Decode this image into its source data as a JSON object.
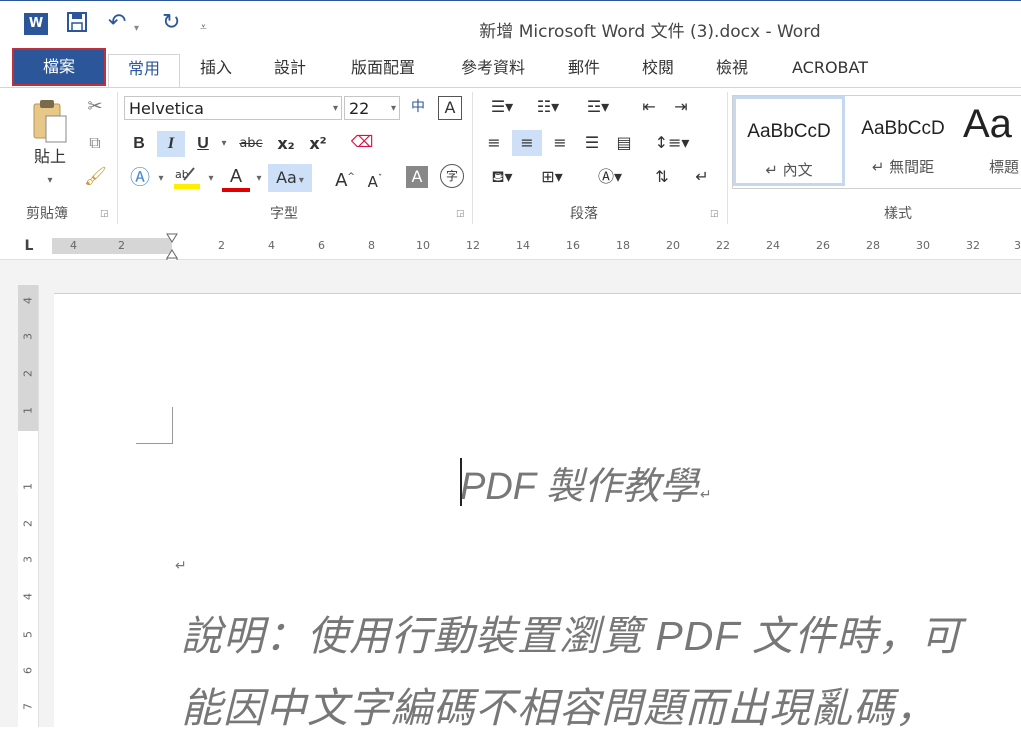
{
  "window": {
    "title": "新增 Microsoft Word 文件 (3).docx - Word"
  },
  "quick_access": {
    "app_icon": "word-icon",
    "save": "save-icon",
    "undo": "undo-icon",
    "redo": "redo-icon",
    "customize": "customize-icon"
  },
  "tabs": [
    {
      "label": "檔案"
    },
    {
      "label": "常用"
    },
    {
      "label": "插入"
    },
    {
      "label": "設計"
    },
    {
      "label": "版面配置"
    },
    {
      "label": "參考資料"
    },
    {
      "label": "郵件"
    },
    {
      "label": "校閱"
    },
    {
      "label": "檢視"
    },
    {
      "label": "ACROBAT"
    }
  ],
  "ribbon": {
    "clipboard": {
      "paste_label": "貼上",
      "group_label": "剪貼簿"
    },
    "font": {
      "family": "Helvetica",
      "size": "22",
      "group_label": "字型",
      "bold": "B",
      "italic": "I",
      "underline": "U",
      "strike": "abc",
      "subscript": "x₂",
      "superscript": "x²",
      "font_color_letter": "A",
      "change_case": "Aa",
      "grow": "A",
      "shrink": "A",
      "zhuyin": "中",
      "boxed": "A",
      "shade": "A",
      "enclosed": "字"
    },
    "paragraph": {
      "group_label": "段落"
    },
    "styles": {
      "group_label": "樣式",
      "items": [
        {
          "sample": "AaBbCcD",
          "name": "↵ 內文"
        },
        {
          "sample": "AaBbCcD",
          "name": "↵ 無間距"
        },
        {
          "sample": "Aa",
          "name": "標題"
        }
      ]
    }
  },
  "ruler": {
    "tab_selector": "L",
    "ticks": [
      "4",
      "2",
      "2",
      "4",
      "6",
      "8",
      "10",
      "12",
      "14",
      "16",
      "18",
      "20",
      "22",
      "24",
      "26",
      "28",
      "30",
      "32",
      "3"
    ],
    "vertical_ticks": [
      "4",
      "3",
      "2",
      "1",
      "1",
      "2",
      "3",
      "4",
      "5",
      "6",
      "7"
    ]
  },
  "document": {
    "heading": "PDF 製作教學",
    "paragraph_mark": "↵",
    "body_line1": "說明：使用行動裝置瀏覽 PDF 文件時，可",
    "body_line2": "能因中文字編碼不相容問題而出現亂碼，"
  },
  "colors": {
    "accent": "#2b579a",
    "file_tab_outline": "#c0303a",
    "highlight": "#cde0f7"
  }
}
